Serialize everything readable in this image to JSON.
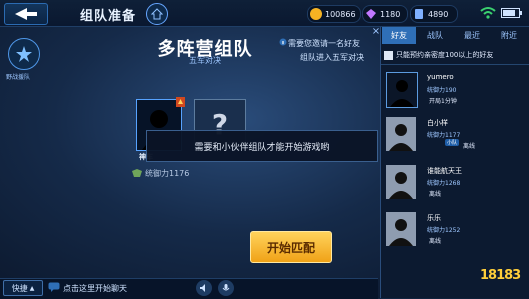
{
  "header": {
    "title": "组队准备",
    "currency": [
      {
        "icon": "gold-coin-icon",
        "value": "100866",
        "color": "#f5b323"
      },
      {
        "icon": "diamond-icon",
        "value": "1180",
        "color": "#c178ff"
      },
      {
        "icon": "voucher-icon",
        "value": "4890",
        "color": "#7fb0ff"
      }
    ]
  },
  "left_panel": {
    "label": "野战援队"
  },
  "mode": {
    "title": "多阵营组队",
    "subtitle": "五军对决",
    "hint_line1": "需要您邀请一名好友",
    "hint_line2": "组队进入五军对决"
  },
  "slots": {
    "player_name": "神车",
    "player_power": "统御力1176",
    "empty_symbol": "?"
  },
  "toast": "需要和小伙伴组队才能开始游戏哟",
  "start_button": "开始匹配",
  "chat": {
    "quick_label": "快捷",
    "placeholder": "点击这里开始聊天"
  },
  "friends_panel": {
    "tabs": [
      "好友",
      "战队",
      "最近",
      "附近"
    ],
    "close": "×",
    "reserve_label": "只能预约亲密度100以上的好友",
    "friends": [
      {
        "name": "yumero",
        "power": "统御力190",
        "status": "开局1分钟",
        "online": true
      },
      {
        "name": "白小样",
        "power": "统御力1177",
        "status": "离线",
        "online": false,
        "badge": "小队"
      },
      {
        "name": "谁能航天王",
        "power": "统御力1268",
        "status": "离线",
        "online": false
      },
      {
        "name": "乐乐",
        "power": "统御力1252",
        "status": "离线",
        "online": false
      }
    ]
  },
  "watermark": "18183"
}
